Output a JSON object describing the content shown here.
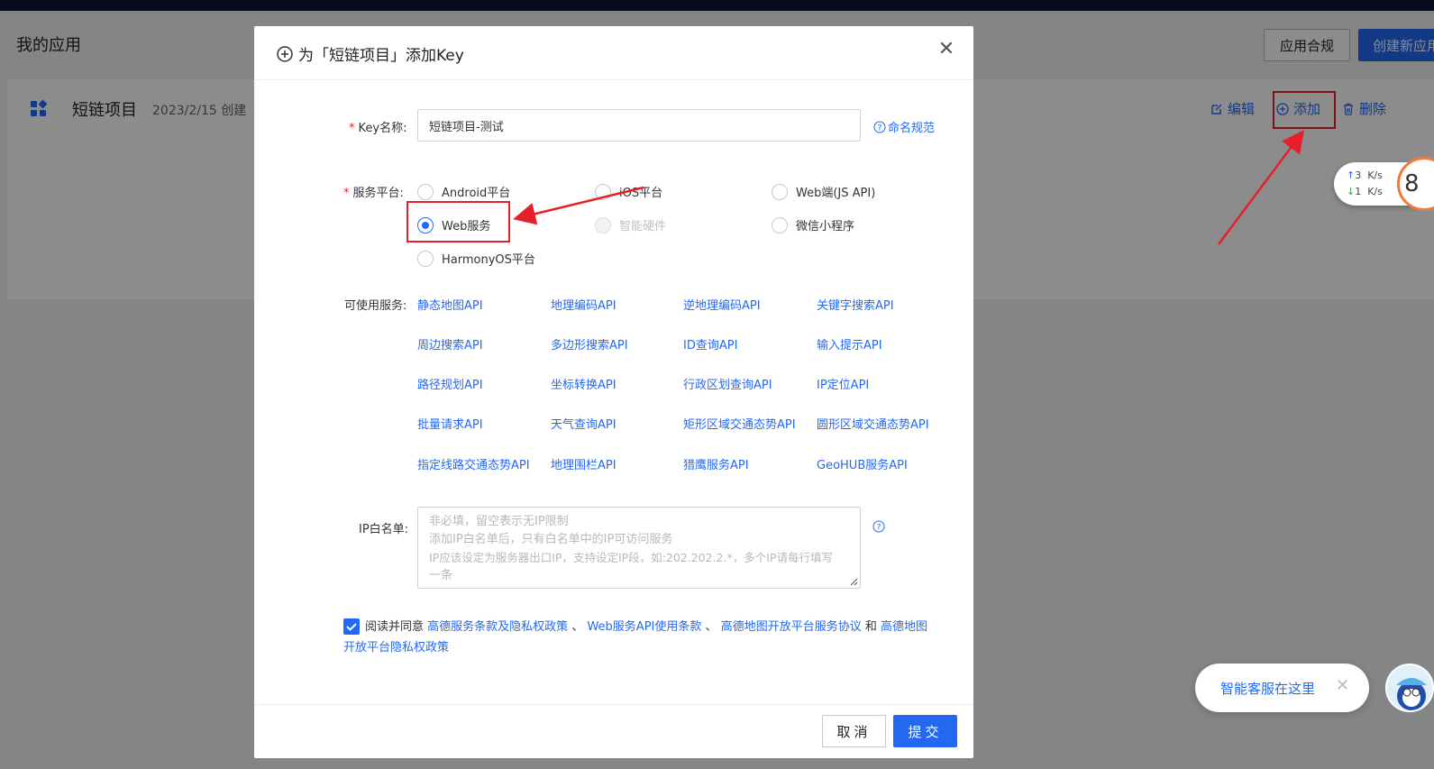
{
  "page": {
    "title": "我的应用",
    "compliance_button": "应用合规",
    "create_button": "创建新应用"
  },
  "project": {
    "name": "短链项目",
    "date": "2023/2/15 创建",
    "actions": {
      "edit": "编辑",
      "add": "添加",
      "delete": "删除"
    }
  },
  "network_speed": {
    "up": "3",
    "down": "1",
    "unit": "K/s",
    "badge": "8"
  },
  "chat": {
    "text": "智能客服在这里",
    "close": "✕"
  },
  "modal": {
    "title": "为「短链项目」添加Key",
    "close": "✕",
    "key_label": "Key名称:",
    "key_value": "短链项目-测试",
    "naming_rule": "命名规范",
    "platform_label": "服务平台:",
    "platforms": [
      {
        "label": "Android平台",
        "checked": false,
        "disabled": false
      },
      {
        "label": "iOS平台",
        "checked": false,
        "disabled": false
      },
      {
        "label": "Web端(JS API)",
        "checked": false,
        "disabled": false
      },
      {
        "label": "Web服务",
        "checked": true,
        "disabled": false
      },
      {
        "label": "智能硬件",
        "checked": false,
        "disabled": true
      },
      {
        "label": "微信小程序",
        "checked": false,
        "disabled": false
      },
      {
        "label": "HarmonyOS平台",
        "checked": false,
        "disabled": false
      }
    ],
    "services_label": "可使用服务:",
    "services": [
      "静态地图API",
      "地理编码API",
      "逆地理编码API",
      "关键字搜索API",
      "周边搜索API",
      "多边形搜索API",
      "ID查询API",
      "输入提示API",
      "路径规划API",
      "坐标转换API",
      "行政区划查询API",
      "IP定位API",
      "批量请求API",
      "天气查询API",
      "矩形区域交通态势API",
      "圆形区域交通态势API",
      "指定线路交通态势API",
      "地理围栏API",
      "猎鹰服务API",
      "GeoHUB服务API"
    ],
    "ip_label": "IP白名单:",
    "ip_placeholder_lines": [
      "非必填，留空表示无IP限制",
      "添加IP白名单后，只有白名单中的IP可访问服务",
      "IP应该设定为服务器出口IP，支持设定IP段，如:202.202.2.*，多个IP请每行填写",
      "一条"
    ],
    "agreement": {
      "prefix": "阅读并同意",
      "link1": "高德服务条款及隐私权政策",
      "sep1": "、",
      "link2": "Web服务API使用条款",
      "sep2": "、",
      "link3": "高德地图开放平台服务协议",
      "and": "和",
      "link4": "高德地图开放平台隐私权政策"
    },
    "cancel": "取消",
    "submit": "提交"
  },
  "colors": {
    "primary": "#2468f2",
    "annotation_red": "#e5202a",
    "top_bar": "#0c1330"
  }
}
